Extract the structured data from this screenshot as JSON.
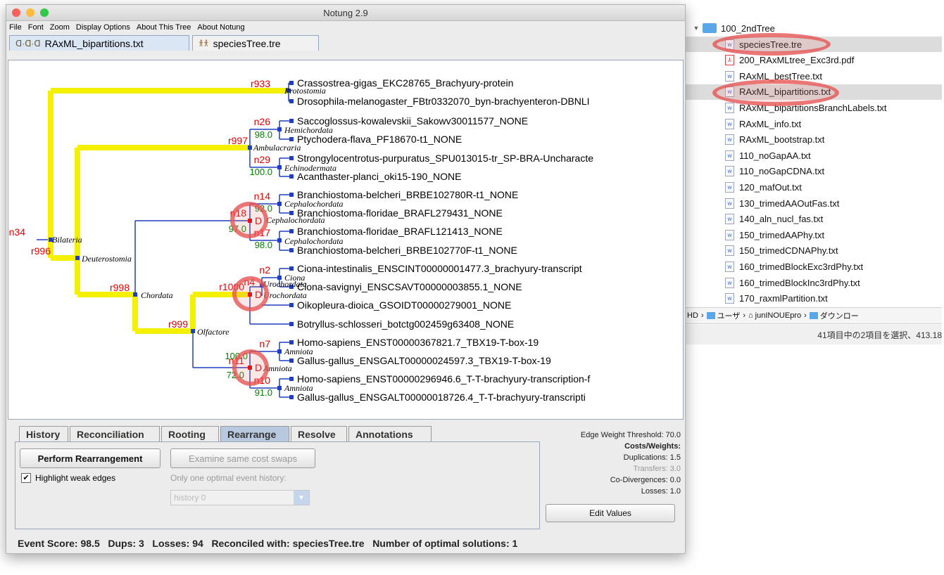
{
  "window": {
    "title": "Notung 2.9",
    "menu": [
      "File",
      "Font",
      "Zoom",
      "Display Options",
      "About This Tree",
      "About Notung"
    ],
    "doc_tabs": [
      "RAxML_bipartitions.txt",
      "speciesTree.tre"
    ]
  },
  "tree": {
    "leaves": [
      "Crassostrea-gigas_EKC28765_Brachyury-protein",
      "Drosophila-melanogaster_FBtr0332070_byn-brachyenteron-DBNLI",
      "Saccoglossus-kowalevskii_Sakowv30011577_NONE",
      "Ptychodera-flava_PF18670-t1_NONE",
      "Strongylocentrotus-purpuratus_SPU013015-tr_SP-BRA-Uncharacte",
      "Acanthaster-planci_oki15-190_NONE",
      "Branchiostoma-belcheri_BRBE102780R-t1_NONE",
      "Branchiostoma-floridae_BRAFL279431_NONE",
      "Branchiostoma-floridae_BRAFL121413_NONE",
      "Branchiostoma-belcheri_BRBE102770F-t1_NONE",
      "Ciona-intestinalis_ENSCINT00000001477.3_brachyury-transcript",
      "Ciona-savignyi_ENSCSAVT00000003855.1_NONE",
      "Oikopleura-dioica_GSOIDT00000279001_NONE",
      "Botryllus-schlosseri_botctg002459g63408_NONE",
      "Homo-sapiens_ENST00000367821.7_TBX19-T-box-19",
      "Gallus-gallus_ENSGALT00000024597.3_TBX19-T-box-19",
      "Homo-sapiens_ENST00000296946.6_T-T-brachyury-transcription-f",
      "Gallus-gallus_ENSGALT00000018726.4_T-T-brachyury-transcripti"
    ],
    "node_names": [
      "r933",
      "n26",
      "r997",
      "n29",
      "n14",
      "n18",
      "n17",
      "n34",
      "r996",
      "r998",
      "n2",
      "r1000",
      "n4",
      "r999",
      "n7",
      "n11",
      "n10"
    ],
    "taxa": [
      "Protostomia",
      "Hemichordata",
      "Ambulacraria",
      "Echinodermata",
      "Cephalochordata",
      "Cephalochordata",
      "Cephalochordata",
      "Bilateria",
      "Deuterostomia",
      "Chordata",
      "Ciona",
      "Urochordata",
      "Urochordata",
      "Olfactore",
      "Amniota",
      "Amniota",
      "Amniota"
    ],
    "support": [
      "98.0",
      "100.0",
      "92.0",
      "97.0",
      "98.0",
      "100.0",
      "72.0",
      "91.0"
    ],
    "dup_marker": "D"
  },
  "panel": {
    "tabs": [
      "History",
      "Reconciliation",
      "Rooting",
      "Rearrange",
      "Resolve",
      "Annotations"
    ],
    "active_tab": "Rearrange",
    "perform_button": "Perform Rearrangement",
    "examine_button": "Examine same cost swaps",
    "highlight_label": "Highlight weak edges",
    "only_one_label": "Only one optimal event history:",
    "history_select": "history 0",
    "edge_threshold": "Edge Weight Threshold: 70.0",
    "costs_heading": "Costs/Weights:",
    "duplications": "Duplications: 1.5",
    "transfers": "Transfers: 3.0",
    "codivergences": "Co-Divergences: 0.0",
    "losses": "Losses: 1.0",
    "edit_values": "Edit Values",
    "status": "Event Score: 98.5   Dups: 3   Losses: 94   Reconciled with: speciesTree.tre   Number of optimal solutions: 1"
  },
  "finder": {
    "folder": "100_2ndTree",
    "files": [
      "speciesTree.tre",
      "200_RAxMLtree_Exc3rd.pdf",
      "RAxML_bestTree.txt",
      "RAxML_bipartitions.txt",
      "RAxML_bipartitionsBranchLabels.txt",
      "RAxML_info.txt",
      "RAxML_bootstrap.txt",
      "110_noGapAA.txt",
      "110_noGapCDNA.txt",
      "120_mafOut.txt",
      "130_trimedAAOutFas.txt",
      "140_aln_nucl_fas.txt",
      "150_trimedAAPhy.txt",
      "150_trimedCDNAPhy.txt",
      "160_trimedBlockExc3rdPhy.txt",
      "160_trimedBlockInc3rdPhy.txt",
      "170_raxmlPartition.txt"
    ],
    "path": [
      "HD",
      "ユーザ",
      "junINOUEpro",
      "ダウンロー"
    ],
    "status": "41項目中の2項目を選択、413.18"
  },
  "colors": {
    "yellow_branch": "#f5f000",
    "blue_branch": "#1f3fbf",
    "node_name": "#e00000",
    "support": "#008000",
    "highlight": "#e65050"
  }
}
